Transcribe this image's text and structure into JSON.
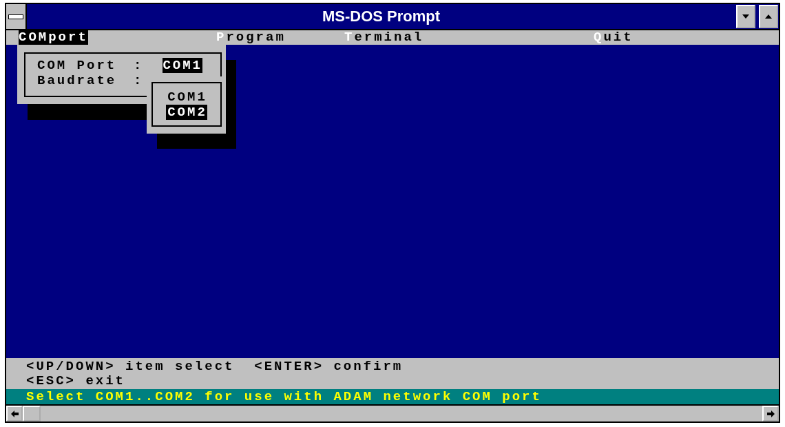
{
  "window": {
    "title": "MS-DOS Prompt"
  },
  "menu": [
    {
      "label": "COMport",
      "selected": true
    },
    {
      "label": "Program",
      "selected": false
    },
    {
      "label": "Terminal",
      "selected": false
    },
    {
      "label": "Quit",
      "selected": false
    }
  ],
  "dialog": {
    "fields": [
      {
        "label": "COM Port",
        "separator": ":",
        "value": "COM1"
      },
      {
        "label": "Baudrate",
        "separator": ":"
      }
    ]
  },
  "dropdown": {
    "options": [
      {
        "label": "COM1",
        "selected": false
      },
      {
        "label": "COM2",
        "selected": true
      }
    ]
  },
  "help_lines": [
    "<UP/DOWN> item select  <ENTER> confirm",
    "<ESC> exit"
  ],
  "status_bar": "Select COM1..COM2 for use with ADAM network COM port"
}
